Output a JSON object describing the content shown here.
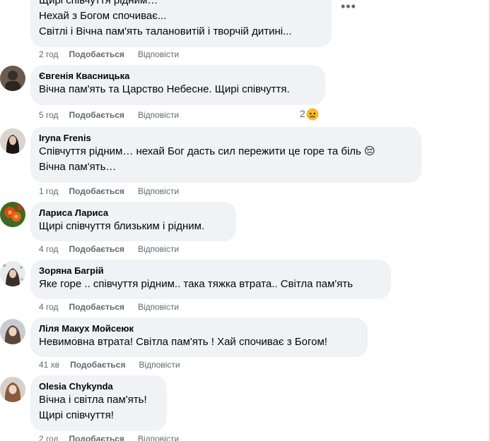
{
  "comments": [
    {
      "author": "",
      "lines": [
        "Щирі співчуття рідним…",
        "Нехай з Богом спочиває...",
        "Світлі і Вічна пам'ять талановитій і творчій дитині..."
      ],
      "time": "2 год",
      "like": "Подобається",
      "reply": "Відповісти"
    },
    {
      "author": "Євгенія Квасницька",
      "lines": [
        "Вічна пам'ять та Царство Небесне. Щирі співчуття."
      ],
      "time": "5 год",
      "like": "Подобається",
      "reply": "Відповісти",
      "reaction_count": "2",
      "reaction_icon": "sad-reaction-icon"
    },
    {
      "author": "Iryna Frenis",
      "lines": [
        "Співчуття рідним… нехай Бог дасть сил пережити це горе та біль 😔",
        "Вічна пам'ять…"
      ],
      "time": "1 год",
      "like": "Подобається",
      "reply": "Відповісти"
    },
    {
      "author": "Лариса Лариса",
      "lines": [
        "Щирі співчуття близьким і рідним."
      ],
      "time": "4 год",
      "like": "Подобається",
      "reply": "Відповісти"
    },
    {
      "author": "Зоряна Багрій",
      "lines": [
        "Яке горе .. співчуття рідним.. така тяжка втрата.. Світла пам'ять"
      ],
      "time": "4 год",
      "like": "Подобається",
      "reply": "Відповісти"
    },
    {
      "author": "Ліля Макух Мойсеюк",
      "lines": [
        "Невимовна втрата! Світла пам'ять ! Хай спочиває з Богом!"
      ],
      "time": "41 хв",
      "like": "Подобається",
      "reply": "Відповісти"
    },
    {
      "author": "Olesia Chykynda",
      "lines": [
        "Вічна і світла пам'ять!",
        "Щирі співчуття!"
      ],
      "time": "2 год",
      "like": "Подобається",
      "reply": "Відповісти"
    }
  ],
  "colors": {
    "bubble": "#f0f2f5",
    "meta_text": "#65676b",
    "text": "#050505"
  }
}
